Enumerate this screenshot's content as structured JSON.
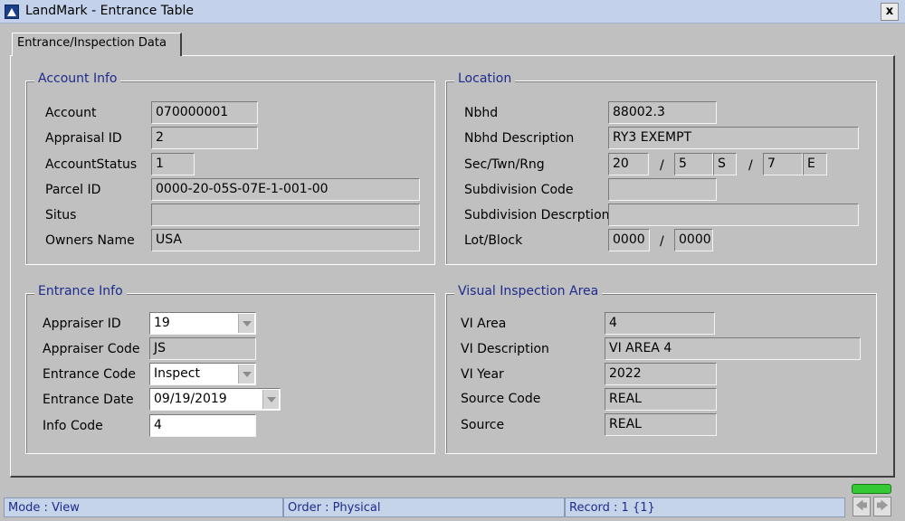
{
  "window": {
    "title": "LandMark - Entrance Table",
    "close_label": "x"
  },
  "tab": {
    "label": "Entrance/Inspection Data"
  },
  "account_info": {
    "legend": "Account Info",
    "account_label": "Account",
    "account_value": "070000001",
    "appraisal_id_label": "Appraisal ID",
    "appraisal_id_value": "2",
    "account_status_label": "AccountStatus",
    "account_status_value": "1",
    "parcel_id_label": "Parcel ID",
    "parcel_id_value": "0000-20-05S-07E-1-001-00",
    "situs_label": "Situs",
    "situs_value": "",
    "owners_name_label": "Owners Name",
    "owners_name_value": "USA"
  },
  "location": {
    "legend": "Location",
    "nbhd_label": "Nbhd",
    "nbhd_value": "88002.3",
    "nbhd_desc_label": "Nbhd Description",
    "nbhd_desc_value": "RY3 EXEMPT",
    "str_label": "Sec/Twn/Rng",
    "sec_value": "20",
    "sep1": "/",
    "twn_value": "5",
    "twn_dir": "S",
    "sep2": "/",
    "rng_value": "7",
    "rng_dir": "E",
    "subdiv_code_label": "Subdivision Code",
    "subdiv_code_value": "",
    "subdiv_desc_label": "Subdivision Descrption",
    "subdiv_desc_value": "",
    "lot_block_label": "Lot/Block",
    "lot_value": "0000",
    "sep3": "/",
    "block_value": "0000"
  },
  "entrance_info": {
    "legend": "Entrance Info",
    "appraiser_id_label": "Appraiser ID",
    "appraiser_id_value": "19",
    "appraiser_code_label": "Appraiser Code",
    "appraiser_code_value": "JS",
    "entrance_code_label": "Entrance Code",
    "entrance_code_value": "Inspect",
    "entrance_date_label": "Entrance Date",
    "entrance_date_value": "09/19/2019",
    "info_code_label": "Info Code",
    "info_code_value": "4"
  },
  "visual_inspection": {
    "legend": "Visual Inspection Area",
    "vi_area_label": "VI Area",
    "vi_area_value": "4",
    "vi_desc_label": "VI Description",
    "vi_desc_value": "VI AREA 4",
    "vi_year_label": "VI Year",
    "vi_year_value": "2022",
    "source_code_label": "Source Code",
    "source_code_value": "REAL",
    "source_label": "Source",
    "source_value": "REAL"
  },
  "status": {
    "mode": "Mode : View",
    "order": "Order : Physical",
    "record": "Record : 1 {1}",
    "prev_glyph": "🡄",
    "next_glyph": "🡆"
  },
  "colors": {
    "legend": "#1e2a8c",
    "titlebar": "#c3d2ea",
    "indicator": "#36c936"
  },
  "icons": [
    "app-icon",
    "close-icon",
    "dropdown-arrow-icon",
    "prev-record-icon",
    "next-record-icon"
  ]
}
